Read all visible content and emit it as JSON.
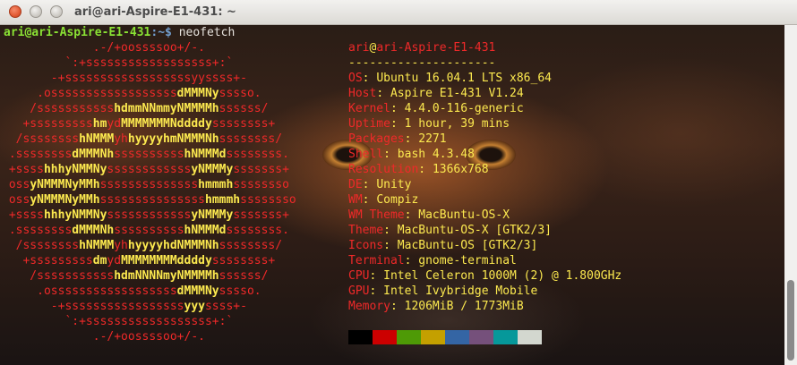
{
  "window": {
    "title": "ari@ari-Aspire-E1-431: ~"
  },
  "prompt": {
    "user_host": "ari@ari-Aspire-E1-431",
    "path": ":~$",
    "command": "neofetch"
  },
  "logo_lines": [
    [
      [
        "r",
        "             .-/+oossssoo+/-."
      ]
    ],
    [
      [
        "r",
        "         `:+ssssssssssssssssss+:`"
      ]
    ],
    [
      [
        "r",
        "       -+ssssssssssssssssssyyssss+-"
      ]
    ],
    [
      [
        "r",
        "     .ossssssssssssssssss"
      ],
      [
        "y",
        "dMMMNy"
      ],
      [
        "r",
        "sssso."
      ]
    ],
    [
      [
        "r",
        "    /sssssssssss"
      ],
      [
        "y",
        "hdmmNNmmyNMMMMh"
      ],
      [
        "r",
        "ssssss/"
      ]
    ],
    [
      [
        "r",
        "   +sssssssss"
      ],
      [
        "y",
        "hm"
      ],
      [
        "r",
        "yd"
      ],
      [
        "y",
        "MMMMMMMNddddy"
      ],
      [
        "r",
        "ssssssss+"
      ]
    ],
    [
      [
        "r",
        "  /ssssssss"
      ],
      [
        "y",
        "hNMMM"
      ],
      [
        "r",
        "yh"
      ],
      [
        "y",
        "hyyyyhmNMMMNh"
      ],
      [
        "r",
        "ssssssss/"
      ]
    ],
    [
      [
        "r",
        " .ssssssss"
      ],
      [
        "y",
        "dMMMNh"
      ],
      [
        "r",
        "ssssssssss"
      ],
      [
        "y",
        "hNMMMd"
      ],
      [
        "r",
        "ssssssss."
      ]
    ],
    [
      [
        "r",
        " +ssss"
      ],
      [
        "y",
        "hhhyNMMNy"
      ],
      [
        "r",
        "ssssssssssss"
      ],
      [
        "y",
        "yNMMMy"
      ],
      [
        "r",
        "sssssss+"
      ]
    ],
    [
      [
        "r",
        " oss"
      ],
      [
        "y",
        "yNMMMNyMMh"
      ],
      [
        "r",
        "ssssssssssssss"
      ],
      [
        "y",
        "hmmmh"
      ],
      [
        "r",
        "ssssssso"
      ]
    ],
    [
      [
        "r",
        " oss"
      ],
      [
        "y",
        "yNMMMNyMMh"
      ],
      [
        "r",
        "sssssssssssssss"
      ],
      [
        "y",
        "hmmmh"
      ],
      [
        "r",
        "ssssssso"
      ]
    ],
    [
      [
        "r",
        " +ssss"
      ],
      [
        "y",
        "hhhyNMMNy"
      ],
      [
        "r",
        "ssssssssssss"
      ],
      [
        "y",
        "yNMMMy"
      ],
      [
        "r",
        "sssssss+"
      ]
    ],
    [
      [
        "r",
        " .ssssssss"
      ],
      [
        "y",
        "dMMMNh"
      ],
      [
        "r",
        "ssssssssss"
      ],
      [
        "y",
        "hNMMMd"
      ],
      [
        "r",
        "ssssssss."
      ]
    ],
    [
      [
        "r",
        "  /ssssssss"
      ],
      [
        "y",
        "hNMMM"
      ],
      [
        "r",
        "yh"
      ],
      [
        "y",
        "hyyyyhdNMMMNh"
      ],
      [
        "r",
        "ssssssss/"
      ]
    ],
    [
      [
        "r",
        "   +sssssssss"
      ],
      [
        "y",
        "dm"
      ],
      [
        "r",
        "yd"
      ],
      [
        "y",
        "MMMMMMMMddddy"
      ],
      [
        "r",
        "ssssssss+"
      ]
    ],
    [
      [
        "r",
        "    /sssssssssss"
      ],
      [
        "y",
        "hdmNNNNmyNMMMMh"
      ],
      [
        "r",
        "ssssss/"
      ]
    ],
    [
      [
        "r",
        "     .ossssssssssssssssss"
      ],
      [
        "y",
        "dMMMNy"
      ],
      [
        "r",
        "sssso."
      ]
    ],
    [
      [
        "r",
        "       -+sssssssssssssssss"
      ],
      [
        "y",
        "yyy"
      ],
      [
        "r",
        "ssss+-"
      ]
    ],
    [
      [
        "r",
        "         `:+ssssssssssssssssss+:`"
      ]
    ],
    [
      [
        "r",
        "             .-/+oossssoo+/-."
      ]
    ]
  ],
  "info": {
    "user": "ari",
    "at": "@",
    "host": "ari-Aspire-E1-431",
    "separator": "---------------------",
    "fields": [
      {
        "key": "OS",
        "value": "Ubuntu 16.04.1 LTS x86_64"
      },
      {
        "key": "Host",
        "value": "Aspire E1-431 V1.24"
      },
      {
        "key": "Kernel",
        "value": "4.4.0-116-generic"
      },
      {
        "key": "Uptime",
        "value": "1 hour, 39 mins"
      },
      {
        "key": "Packages",
        "value": "2271"
      },
      {
        "key": "Shell",
        "value": "bash 4.3.48"
      },
      {
        "key": "Resolution",
        "value": "1366x768"
      },
      {
        "key": "DE",
        "value": "Unity"
      },
      {
        "key": "WM",
        "value": "Compiz"
      },
      {
        "key": "WM Theme",
        "value": "MacBuntu-OS-X"
      },
      {
        "key": "Theme",
        "value": "MacBuntu-OS-X [GTK2/3]"
      },
      {
        "key": "Icons",
        "value": "MacBuntu-OS [GTK2/3]"
      },
      {
        "key": "Terminal",
        "value": "gnome-terminal"
      },
      {
        "key": "CPU",
        "value": "Intel Celeron 1000M (2) @ 1.800GHz"
      },
      {
        "key": "GPU",
        "value": "Intel Ivybridge Mobile"
      },
      {
        "key": "Memory",
        "value": "1206MiB / 1773MiB"
      }
    ]
  },
  "colors": {
    "swatches": [
      "#000000",
      "#cc0000",
      "#4e9a06",
      "#c4a000",
      "#3465a4",
      "#75507b",
      "#06989a",
      "#d3d7cf"
    ]
  }
}
